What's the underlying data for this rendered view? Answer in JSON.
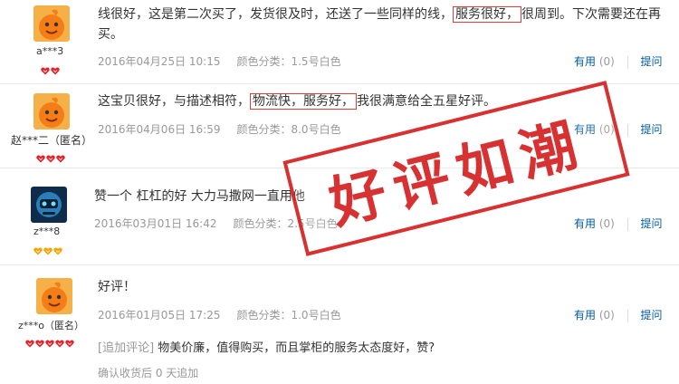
{
  "reviews": [
    {
      "user": "a***3",
      "avatar": "orange-mascot",
      "hearts": 2,
      "heart_color": "#e0242a",
      "text_before": "线很好，这是第二次买了，发货很及时，还送了一些同样的线，",
      "highlight": "服务很好，",
      "text_after": "很周到。下次需要还在再买。",
      "date": "2016年04月25日 10:15",
      "spec": "颜色分类：1.5号白色",
      "useful_label": "有用",
      "useful_count": "(0)",
      "ask_label": "提问"
    },
    {
      "user": "赵***二（匿名）",
      "avatar": "orange-mascot",
      "hearts": 3,
      "heart_color": "#e0242a",
      "text_before": "这宝贝很好，与描述相符，",
      "highlight": "物流快，服务好，",
      "text_after": "我很满意给全五星好评。",
      "date": "2016年04月06日 16:59",
      "spec": "颜色分类：8.0号白色",
      "useful_label": "有用",
      "useful_count": "(0)",
      "ask_label": "提问"
    },
    {
      "user": "z***8",
      "avatar": "robot-blue",
      "hearts": 3,
      "heart_color": "#f5a300",
      "text": "赞一个 杠杠的好 大力马撒网一直用他",
      "date": "2016年03月01日 16:42",
      "spec": "颜色分类：2.5号白色",
      "useful_label": "有用",
      "useful_count": "(0)",
      "ask_label": "提问"
    },
    {
      "user": "z***o（匿名）",
      "avatar": "orange-mascot",
      "hearts": 5,
      "heart_color": "#e0242a",
      "text": "好评！",
      "date": "2016年01月05日 17:25",
      "spec": "颜色分类：1.0号白色",
      "useful_label": "有用",
      "useful_count": "(0)",
      "ask_label": "提问",
      "followup_tag": "[追加评论]",
      "followup_text": "物美价廉，值得购买，而且掌柜的服务太态度好，赞?",
      "confirm": "确认收货后 0 天追加"
    }
  ],
  "stamp": {
    "text": "好评如潮",
    "color": "#d42020"
  }
}
